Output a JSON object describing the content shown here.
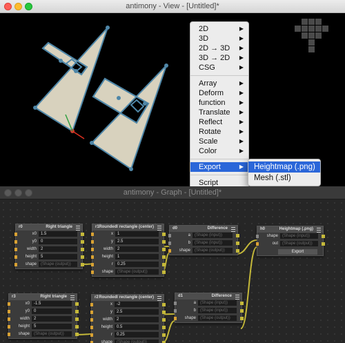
{
  "view_window": {
    "title": "antimony - View - [Untitled]*",
    "viewport": {
      "fill_color": "#d8d2be",
      "outline_color": "#4f87a8"
    }
  },
  "context_menu": {
    "items": [
      {
        "label": "2D",
        "submenu": true
      },
      {
        "label": "3D",
        "submenu": true
      },
      {
        "label": "2D → 3D",
        "submenu": true
      },
      {
        "label": "3D → 2D",
        "submenu": true
      },
      {
        "label": "CSG",
        "submenu": true
      },
      {
        "separator": true
      },
      {
        "label": "Array",
        "submenu": true
      },
      {
        "label": "Deform",
        "submenu": true
      },
      {
        "label": "function",
        "submenu": true
      },
      {
        "label": "Translate",
        "submenu": true
      },
      {
        "label": "Reflect",
        "submenu": true
      },
      {
        "label": "Rotate",
        "submenu": true
      },
      {
        "label": "Scale",
        "submenu": true
      },
      {
        "label": "Color",
        "submenu": true
      },
      {
        "separator": true
      },
      {
        "label": "Export",
        "submenu": true,
        "highlighted": true
      },
      {
        "separator": true
      },
      {
        "label": "Script",
        "submenu": false
      }
    ],
    "arrow_glyph": "▶",
    "highlight_color": "#2a66d9"
  },
  "export_submenu": {
    "items": [
      {
        "label": "Heightmap (.png)",
        "highlighted": true
      },
      {
        "label": "Mesh (.stl)",
        "highlighted": false
      }
    ]
  },
  "graph_window": {
    "title": "antimony - Graph - [Untitled]*",
    "nodes": {
      "r0": {
        "id": "r0",
        "type": "Right triangle",
        "rows": [
          {
            "label": "x0",
            "value": "1.5"
          },
          {
            "label": "y0",
            "value": "0"
          },
          {
            "label": "width",
            "value": "2"
          },
          {
            "label": "height",
            "value": "5"
          },
          {
            "label": "shape",
            "value": "(Shape (output))"
          }
        ]
      },
      "r1": {
        "id": "r1",
        "type": "Roundedl rectangle (center)",
        "rows": [
          {
            "label": "x",
            "value": "1"
          },
          {
            "label": "y",
            "value": "2.5"
          },
          {
            "label": "width",
            "value": "2"
          },
          {
            "label": "height",
            "value": "1"
          },
          {
            "label": "r",
            "value": "0.25"
          },
          {
            "label": "shape",
            "value": "(Shape (output))"
          }
        ]
      },
      "d0": {
        "id": "d0",
        "type": "Difference",
        "rows": [
          {
            "label": "a",
            "value": "(Shape (input))"
          },
          {
            "label": "b",
            "value": "(Shape (input))"
          },
          {
            "label": "shape",
            "value": "(Shape (output))"
          }
        ]
      },
      "h0": {
        "id": "h0",
        "type": "Heightmap (.png)",
        "rows": [
          {
            "label": "shape",
            "value": "(Shape (input))"
          },
          {
            "label": "out",
            "value": "(Shape (output))"
          }
        ],
        "button_label": "Export"
      },
      "r3": {
        "id": "r3",
        "type": "Right triangle",
        "rows": [
          {
            "label": "x0",
            "value": "-1.5"
          },
          {
            "label": "y0",
            "value": "0"
          },
          {
            "label": "width",
            "value": "2"
          },
          {
            "label": "height",
            "value": "5"
          },
          {
            "label": "shape",
            "value": "(Shape (output))"
          }
        ]
      },
      "r2": {
        "id": "r2",
        "type": "Roundedl rectangle (center)",
        "rows": [
          {
            "label": "x",
            "value": "-2"
          },
          {
            "label": "y",
            "value": "2.5"
          },
          {
            "label": "width",
            "value": "2"
          },
          {
            "label": "height",
            "value": "0.5"
          },
          {
            "label": "r",
            "value": "0.25"
          },
          {
            "label": "shape",
            "value": "(Shape (output))"
          }
        ]
      },
      "d1": {
        "id": "d1",
        "type": "Difference",
        "rows": [
          {
            "label": "a",
            "value": "(Shape (input))"
          },
          {
            "label": "b",
            "value": "(Shape (input))"
          },
          {
            "label": "shape",
            "value": "(Shape (output))"
          }
        ]
      }
    },
    "wire_color": "#c5b93a"
  }
}
